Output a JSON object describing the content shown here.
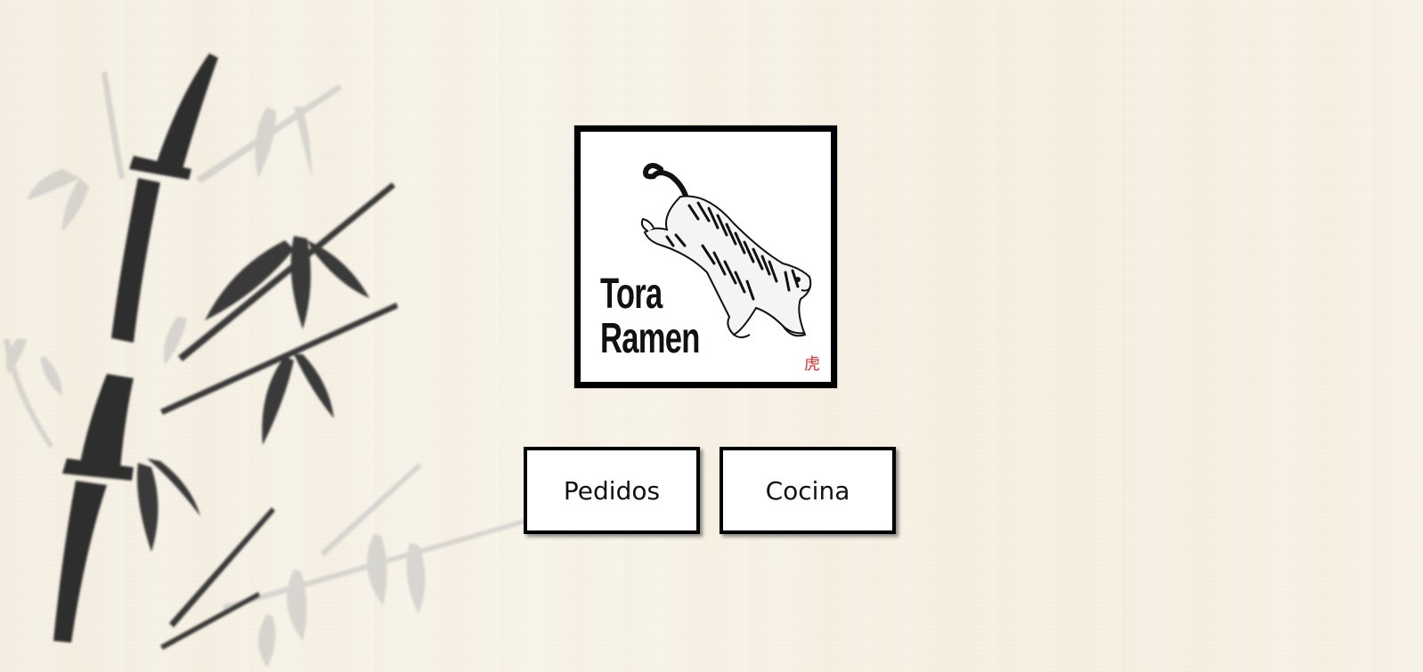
{
  "logo": {
    "line1": "Tora",
    "line2": "Ramen",
    "kanji": "虎",
    "kanji_color": "#e02a2a",
    "icon": "tiger-illustration"
  },
  "background": {
    "icon": "bamboo-ink-painting",
    "color": "#f7f2e7"
  },
  "buttons": {
    "pedidos": "Pedidos",
    "cocina": "Cocina"
  }
}
